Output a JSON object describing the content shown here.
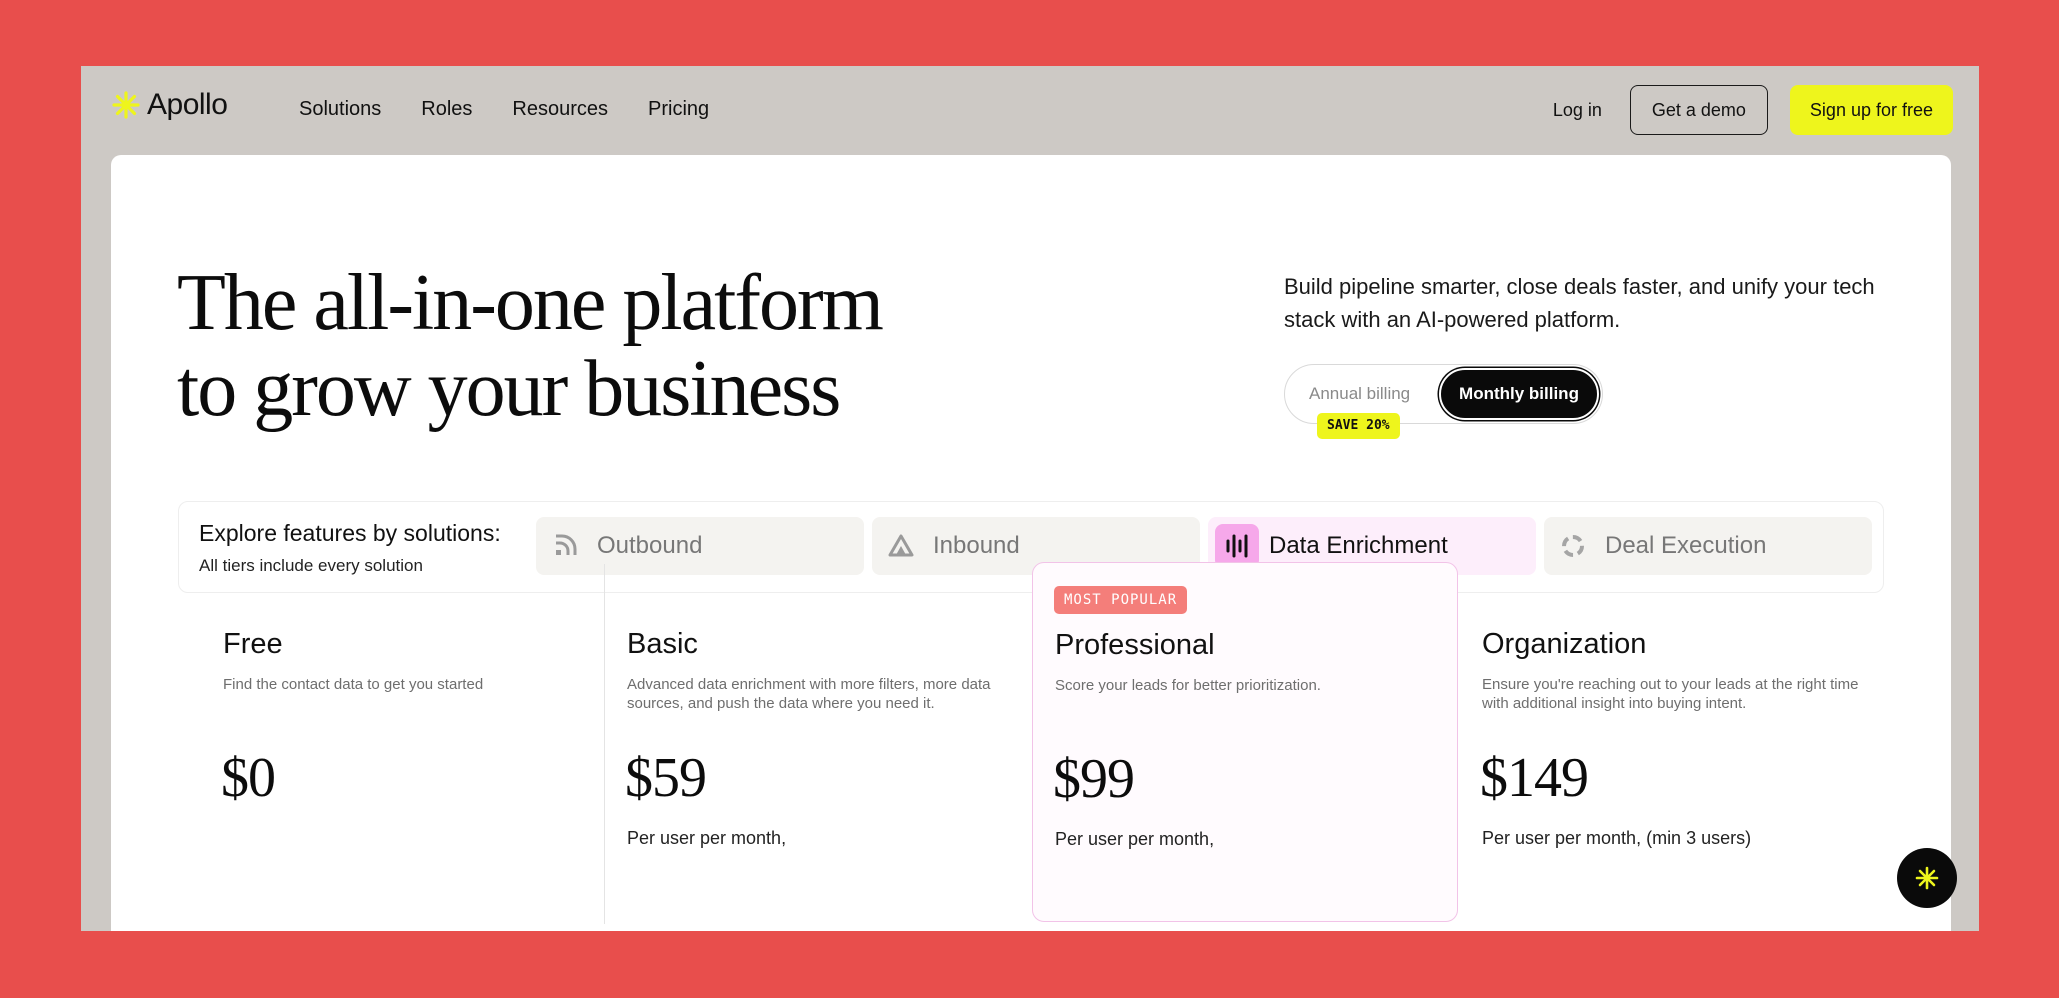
{
  "brand": {
    "name": "Apollo",
    "accent": "#eef51c",
    "background": "#e84e4c"
  },
  "nav": {
    "items": [
      "Solutions",
      "Roles",
      "Resources",
      "Pricing"
    ],
    "login": "Log in",
    "demo": "Get a demo",
    "signup": "Sign up for free"
  },
  "hero": {
    "title_line1": "The all-in-one platform",
    "title_line2": "to grow your business",
    "subtitle": "Build pipeline smarter, close deals faster, and unify your tech stack with an AI-powered platform."
  },
  "billing": {
    "annual": "Annual billing",
    "monthly": "Monthly billing",
    "selected": "monthly",
    "save_badge": "SAVE 20%"
  },
  "solutions": {
    "title": "Explore features by solutions:",
    "subtitle": "All tiers include every solution",
    "tabs": [
      {
        "label": "Outbound",
        "icon": "outbound-icon",
        "active": false
      },
      {
        "label": "Inbound",
        "icon": "inbound-icon",
        "active": false
      },
      {
        "label": "Data Enrichment",
        "icon": "data-enrichment-icon",
        "active": true
      },
      {
        "label": "Deal Execution",
        "icon": "deal-execution-icon",
        "active": false
      }
    ]
  },
  "plans": [
    {
      "name": "Free",
      "desc": "Find the contact data to get you started",
      "price": "$0",
      "per": ""
    },
    {
      "name": "Basic",
      "desc": "Advanced data enrichment with more filters, more data sources, and push the data where you need it.",
      "price": "$59",
      "per": "Per user per month,"
    },
    {
      "name": "Professional",
      "desc": "Score your leads for better prioritization.",
      "price": "$99",
      "per": "Per user per month,",
      "badge": "MOST POPULAR"
    },
    {
      "name": "Organization",
      "desc": "Ensure you're reaching out to your leads at the right time with additional insight into buying intent.",
      "price": "$149",
      "per": "Per user per month, (min 3 users)"
    }
  ],
  "chat": {
    "icon": "apollo-chat-icon"
  }
}
